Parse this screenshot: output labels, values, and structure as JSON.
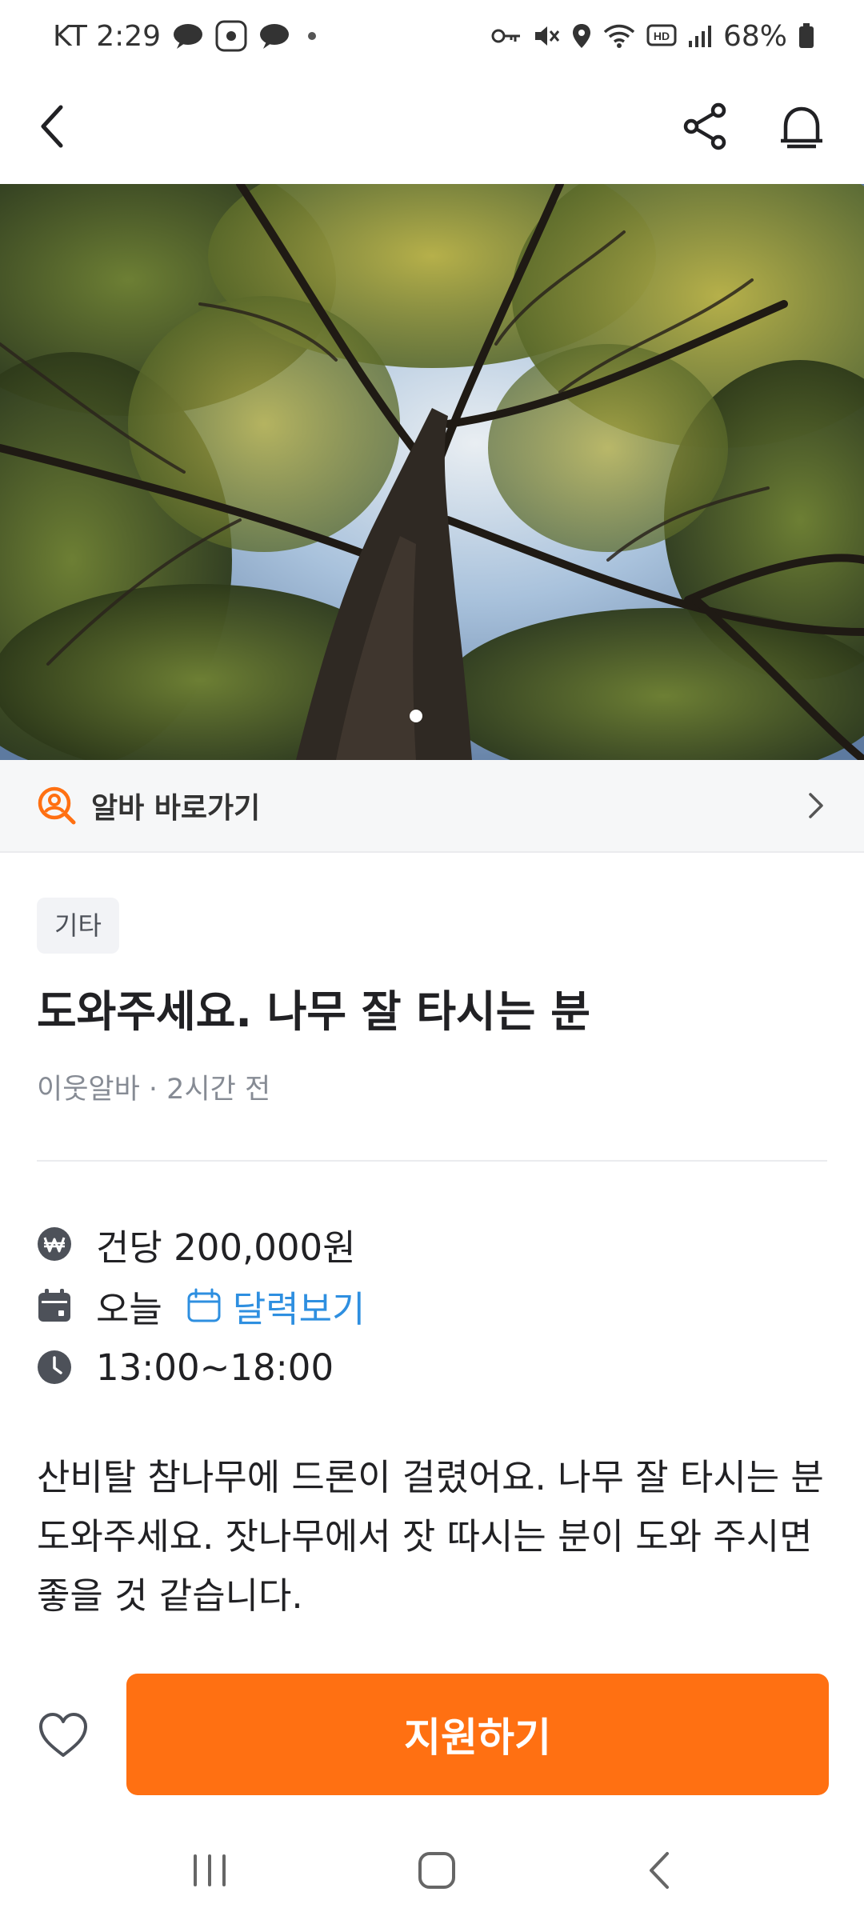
{
  "status_bar": {
    "carrier_time": "KT 2:29",
    "battery": "68%",
    "icons_left": [
      "talk-icon",
      "market-app-icon",
      "talk-icon",
      "dot"
    ],
    "icons_right": [
      "key-icon",
      "mute-icon",
      "location-icon",
      "wifi-icon",
      "hd-icon",
      "signal-icon",
      "battery-icon"
    ]
  },
  "app_bar": {
    "back_icon": "chevron-left-icon",
    "share_icon": "share-icon",
    "alarm_icon": "bell-icon"
  },
  "hero": {
    "image": "tall tree canopy photo",
    "page_indicator": {
      "current": 1,
      "total": 1
    }
  },
  "shortcut": {
    "label": "알바 바로가기",
    "icon": "person-search-icon"
  },
  "post": {
    "category": "기타",
    "title": "도와주세요. 나무 잘 타시는 분",
    "meta": "이웃알바 · 2시간 전",
    "pay": "건당 200,000원",
    "date": "오늘",
    "calendar_link": "달력보기",
    "time": "13:00~18:00",
    "description": "산비탈 참나무에 드론이 걸렸어요. 나무 잘 타시는 분 도와주세요. 잣나무에서 잣 따시는 분이 도와 주시면 좋을 것 같습니다."
  },
  "bottom": {
    "apply_label": "지원하기",
    "like_icon": "heart-outline-icon"
  },
  "colors": {
    "accent": "#ff7012",
    "link": "#2e8fe0",
    "muted": "#868b94"
  }
}
